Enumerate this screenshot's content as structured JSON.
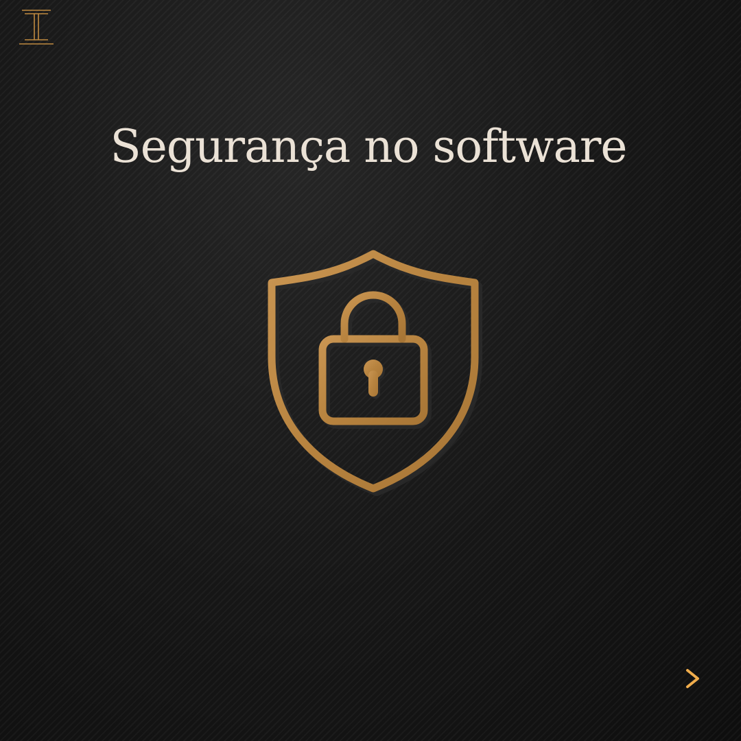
{
  "brand": {
    "logo_icon": "stacked-bars-logo-icon",
    "accent_color": "#c08a40"
  },
  "slide": {
    "title": "Segurança no software",
    "emblem_icon": "shield-padlock-icon",
    "next_icon": "arrow-right-icon"
  },
  "colors": {
    "background": "#151515",
    "title": "#ebe2d6",
    "gold": "#c08a40"
  }
}
